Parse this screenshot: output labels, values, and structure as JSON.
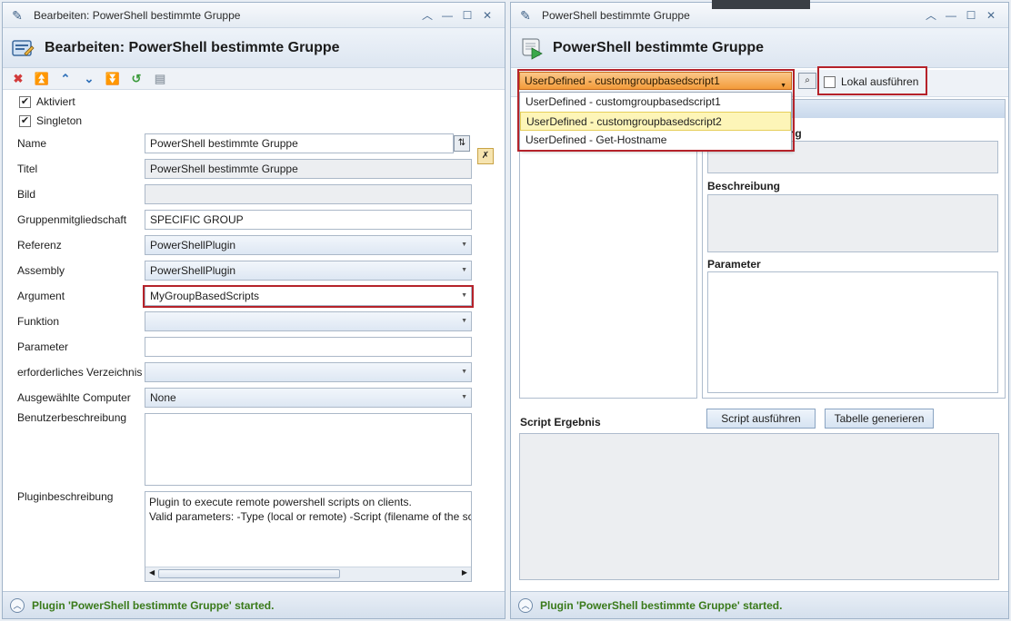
{
  "left": {
    "window_title": "Bearbeiten: PowerShell bestimmte Gruppe",
    "header_title": "Bearbeiten: PowerShell bestimmte Gruppe",
    "window_controls": [
      "︿",
      "—",
      "☐",
      "✕"
    ],
    "toolbar": [
      {
        "name": "delete-icon",
        "glyph": "✖",
        "color": "#d23b3b"
      },
      {
        "name": "move-top-icon",
        "glyph": "⏫",
        "color": "#2c6fb8"
      },
      {
        "name": "move-up-icon",
        "glyph": "⌃",
        "color": "#2c6fb8"
      },
      {
        "name": "move-down-icon",
        "glyph": "⌄",
        "color": "#2c6fb8"
      },
      {
        "name": "move-bottom-icon",
        "glyph": "⏬",
        "color": "#2c6fb8"
      },
      {
        "name": "undo-icon",
        "glyph": "↺",
        "color": "#3a9a3a"
      },
      {
        "name": "clipboard-icon",
        "glyph": "▤",
        "color": "#9aa4ae"
      }
    ],
    "checkboxes": [
      {
        "label": "Aktiviert",
        "checked": true
      },
      {
        "label": "Singleton",
        "checked": true
      }
    ],
    "fields": {
      "name": {
        "label": "Name",
        "value": "PowerShell bestimmte Gruppe"
      },
      "titel": {
        "label": "Titel",
        "value": "PowerShell bestimmte Gruppe"
      },
      "bild": {
        "label": "Bild",
        "value": ""
      },
      "gruppe": {
        "label": "Gruppenmitgliedschaft",
        "value": "SPECIFIC GROUP"
      },
      "referenz": {
        "label": "Referenz",
        "value": "PowerShellPlugin"
      },
      "assembly": {
        "label": "Assembly",
        "value": "PowerShellPlugin"
      },
      "argument": {
        "label": "Argument",
        "value": "MyGroupBasedScripts"
      },
      "funktion": {
        "label": "Funktion",
        "value": ""
      },
      "parameter": {
        "label": "Parameter",
        "value": ""
      },
      "verzeichnis": {
        "label": "erforderliches Verzeichnis",
        "value": ""
      },
      "computer": {
        "label": "Ausgewählte Computer",
        "value": "None"
      },
      "benutzerbeschreibung": {
        "label": "Benutzerbeschreibung",
        "value": ""
      },
      "pluginbeschreibung": {
        "label": "Pluginbeschreibung",
        "line1": "Plugin to execute remote powershell scripts on clients.",
        "line2": "Valid parameters: -Type (local or remote) -Script (filename of the scr"
      }
    },
    "status": "Plugin 'PowerShell bestimmte Gruppe' started."
  },
  "right": {
    "window_title": "PowerShell bestimmte Gruppe",
    "header_title": "PowerShell bestimmte Gruppe",
    "window_controls": [
      "︿",
      "—",
      "☐",
      "✕"
    ],
    "script_select": "UserDefined - customgroupbasedscript1",
    "options": [
      "UserDefined - customgroupbasedscript1",
      "UserDefined - customgroupbasedscript2",
      "UserDefined - Get-Hostname"
    ],
    "lokal_label": "Lokal ausführen",
    "partial_label": "ng",
    "beschreibung_label": "Beschreibung",
    "parameter_label": "Parameter",
    "script_ergebnis_label": "Script Ergebnis",
    "run_button": "Script ausführen",
    "table_button": "Tabelle generieren",
    "status": "Plugin 'PowerShell bestimmte Gruppe' started."
  }
}
